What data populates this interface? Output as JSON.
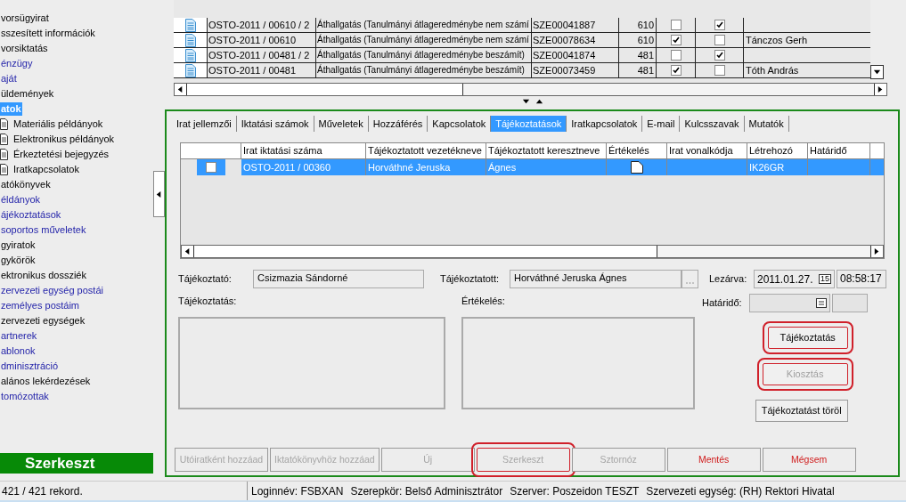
{
  "sidebar": {
    "items": [
      {
        "label": "vorsügyirat",
        "kind": "plain",
        "selected": false
      },
      {
        "label": "sszesített információk",
        "kind": "plain",
        "selected": false
      },
      {
        "label": "vorsiktatás",
        "kind": "plain",
        "selected": false
      },
      {
        "label": "énzügy",
        "kind": "link",
        "selected": false
      },
      {
        "label": "aját",
        "kind": "link",
        "selected": false
      },
      {
        "label": "üldemények",
        "kind": "plain",
        "selected": false
      },
      {
        "label": "atok",
        "kind": "link",
        "selected": true,
        "children": [
          {
            "label": "Materiális példányok",
            "selected": false
          },
          {
            "label": "Elektronikus példányok",
            "selected": false
          },
          {
            "label": "Érkeztetési bejegyzés",
            "selected": false
          },
          {
            "label": "Iratkapcsolatok",
            "selected": false
          }
        ]
      },
      {
        "label": "atókönyvek",
        "kind": "plain",
        "selected": false
      },
      {
        "label": "éldányok",
        "kind": "link",
        "selected": false
      },
      {
        "label": "ájékoztatások",
        "kind": "link",
        "selected": false
      },
      {
        "label": "soportos műveletek",
        "kind": "link",
        "selected": false
      },
      {
        "label": "gyiratok",
        "kind": "plain",
        "selected": false
      },
      {
        "label": "gykörök",
        "kind": "plain",
        "selected": false
      },
      {
        "label": "ektronikus dossziék",
        "kind": "plain",
        "selected": false
      },
      {
        "label": "zervezeti egység postái",
        "kind": "link",
        "selected": false
      },
      {
        "label": "zemélyes postáim",
        "kind": "link",
        "selected": false
      },
      {
        "label": "zervezeti egységek",
        "kind": "plain",
        "selected": false
      },
      {
        "label": "artnerek",
        "kind": "link",
        "selected": false
      },
      {
        "label": "ablonok",
        "kind": "link",
        "selected": false
      },
      {
        "label": "dminisztráció",
        "kind": "link",
        "selected": false
      },
      {
        "label": "alános lekérdezések",
        "kind": "plain",
        "selected": false
      },
      {
        "label": "tomózottak",
        "kind": "link",
        "selected": false
      }
    ],
    "mode_banner": "Szerkeszt",
    "record_count": "421 / 421 rekord."
  },
  "documents": {
    "rows": [
      {
        "number": "OSTO-2011 / 00610 / 2",
        "subject": "Áthallgatás (Tanulmányi átlageredménybe nem számí",
        "barcode": "SZE00041887",
        "code": "610",
        "check_1": false,
        "check_2": true,
        "name": ""
      },
      {
        "number": "OSTO-2011 / 00610",
        "subject": "Áthallgatás (Tanulmányi átlageredménybe nem számí",
        "barcode": "SZE00078634",
        "code": "610",
        "check_1": true,
        "check_2": false,
        "name": "Tánczos Gerh"
      },
      {
        "number": "OSTO-2011 / 00481 / 2",
        "subject": "Áthallgatás (Tanulmányi átlageredménybe beszámít)",
        "barcode": "SZE00041874",
        "code": "481",
        "check_1": false,
        "check_2": true,
        "name": ""
      },
      {
        "number": "OSTO-2011 / 00481",
        "subject": "Áthallgatás (Tanulmányi átlageredménybe beszámít)",
        "barcode": "SZE00073459",
        "code": "481",
        "check_1": true,
        "check_2": false,
        "name": "Tóth András"
      }
    ]
  },
  "tabs": [
    {
      "label": "Irat jellemzői",
      "selected": false
    },
    {
      "label": "Iktatási számok",
      "selected": false
    },
    {
      "label": "Műveletek",
      "selected": false
    },
    {
      "label": "Hozzáférés",
      "selected": false
    },
    {
      "label": "Kapcsolatok",
      "selected": false
    },
    {
      "label": "Tájékoztatások",
      "selected": true
    },
    {
      "label": "Iratkapcsolatok",
      "selected": false
    },
    {
      "label": "E-mail",
      "selected": false
    },
    {
      "label": "Kulcsszavak",
      "selected": false
    },
    {
      "label": "Mutatók",
      "selected": false
    }
  ],
  "notices": {
    "columns": [
      "Irat iktatási száma",
      "Tájékoztatott vezetékneve",
      "Tájékoztatott keresztneve",
      "Értékelés",
      "Irat vonalkódja",
      "Létrehozó",
      "Határidő"
    ],
    "rows": [
      {
        "selected": true,
        "checked": false,
        "number": "OSTO-2011 / 00360",
        "last_name": "Horváthné Jeruska",
        "first_name": "Ágnes",
        "barcode": "",
        "creator": "IK26GR",
        "deadline": ""
      }
    ]
  },
  "form": {
    "informer_label": "Tájékoztató:",
    "informer": "Csizmazia Sándorné",
    "informed_label": "Tájékoztatott:",
    "informed": "Horváthné Jeruska Ágnes",
    "closed_label": "Lezárva:",
    "closed_date": "2011.01.27.",
    "closed_time": "08:58:17",
    "calendar_day": "15",
    "notice_label": "Tájékoztatás:",
    "evaluation_label": "Értékelés:",
    "deadline_label": "Határidő:"
  },
  "side_buttons": [
    {
      "label": "Tájékoztatás",
      "disabled": false,
      "highlighted": true
    },
    {
      "label": "Kiosztás",
      "disabled": true,
      "highlighted": true
    },
    {
      "label": "Tájékoztatást töröl",
      "disabled": false,
      "highlighted": false
    }
  ],
  "bottom_buttons": [
    {
      "label": "Utóiratként hozzáad",
      "disabled": true,
      "kind": "plain",
      "highlighted": false
    },
    {
      "label": "Iktatókönyvhöz hozzáad",
      "disabled": true,
      "kind": "plain",
      "highlighted": false
    },
    {
      "label": "Új",
      "disabled": true,
      "kind": "plain",
      "highlighted": false
    },
    {
      "label": "Szerkeszt",
      "disabled": true,
      "kind": "plain",
      "highlighted": true
    },
    {
      "label": "Sztornóz",
      "disabled": true,
      "kind": "plain",
      "highlighted": false
    },
    {
      "label": "Mentés",
      "disabled": false,
      "kind": "danger",
      "highlighted": false
    },
    {
      "label": "Mégsem",
      "disabled": false,
      "kind": "danger",
      "highlighted": false
    }
  ],
  "status_bar": [
    "Loginnév: FSBXAN",
    "Szerepkör: Belső Adminisztrátor",
    "Szerver: Poszeidon TESZT",
    "Szervezeti egység: (RH) Rektori Hivatal"
  ]
}
